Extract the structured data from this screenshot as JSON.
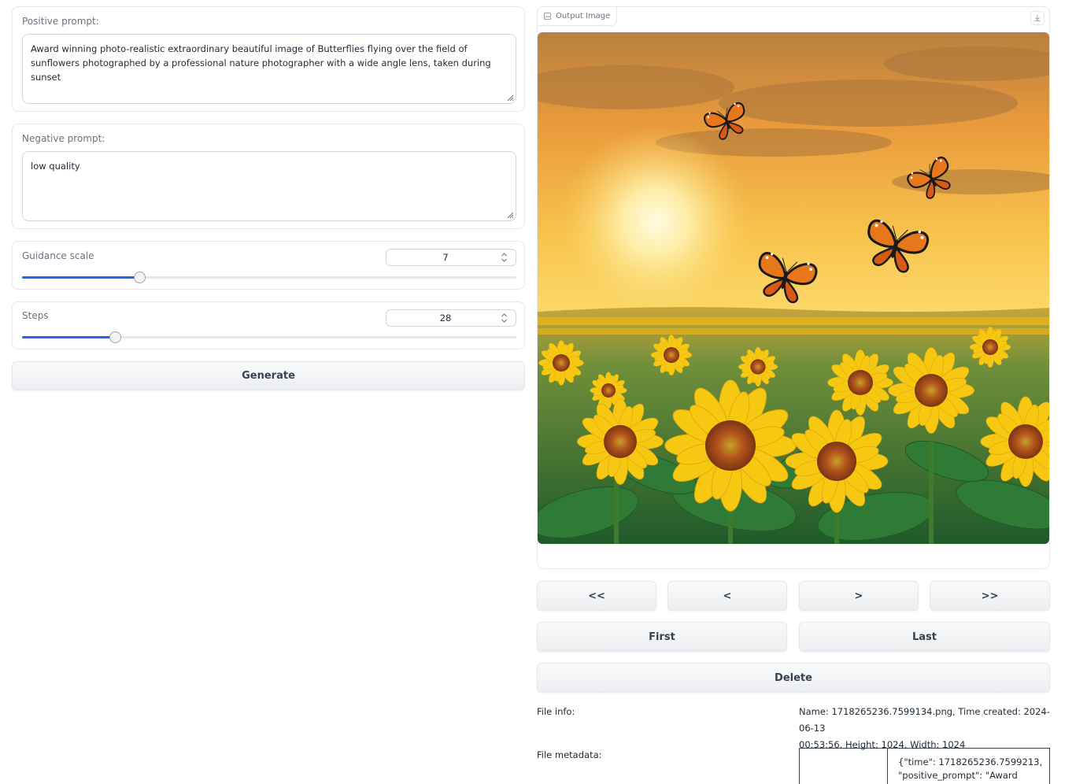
{
  "positive_prompt": {
    "label": "Positive prompt:",
    "value": "Award winning photo-realistic extraordinary beautiful image of Butterflies flying over the field of sunflowers photographed by a professional nature photographer with a wide angle lens, taken during sunset"
  },
  "negative_prompt": {
    "label": "Negative prompt:",
    "value": "low quality"
  },
  "guidance_scale": {
    "label": "Guidance scale",
    "value": "7",
    "fraction": 0.238
  },
  "steps": {
    "label": "Steps",
    "value": "28",
    "fraction": 0.188
  },
  "generate_label": "Generate",
  "output": {
    "tab_label": "Output Image",
    "icons": {
      "image": "image-icon",
      "download": "download-icon"
    }
  },
  "nav": {
    "first_page": "<<",
    "prev": "<",
    "next": ">",
    "last_page": ">>",
    "first": "First",
    "last": "Last",
    "delete": "Delete"
  },
  "file_info": {
    "label": "File info:",
    "line1": "Name: 1718265236.7599134.png, Time created: 2024-06-13",
    "line2": "00:53:56, Height: 1024, Width: 1024"
  },
  "file_metadata": {
    "label": "File metadata:",
    "line1": "{\"time\": 1718265236.7599213,",
    "line2": "\"positive_prompt\": \"Award"
  },
  "colors": {
    "accent": "#2563eb",
    "border": "#e5e7eb"
  }
}
